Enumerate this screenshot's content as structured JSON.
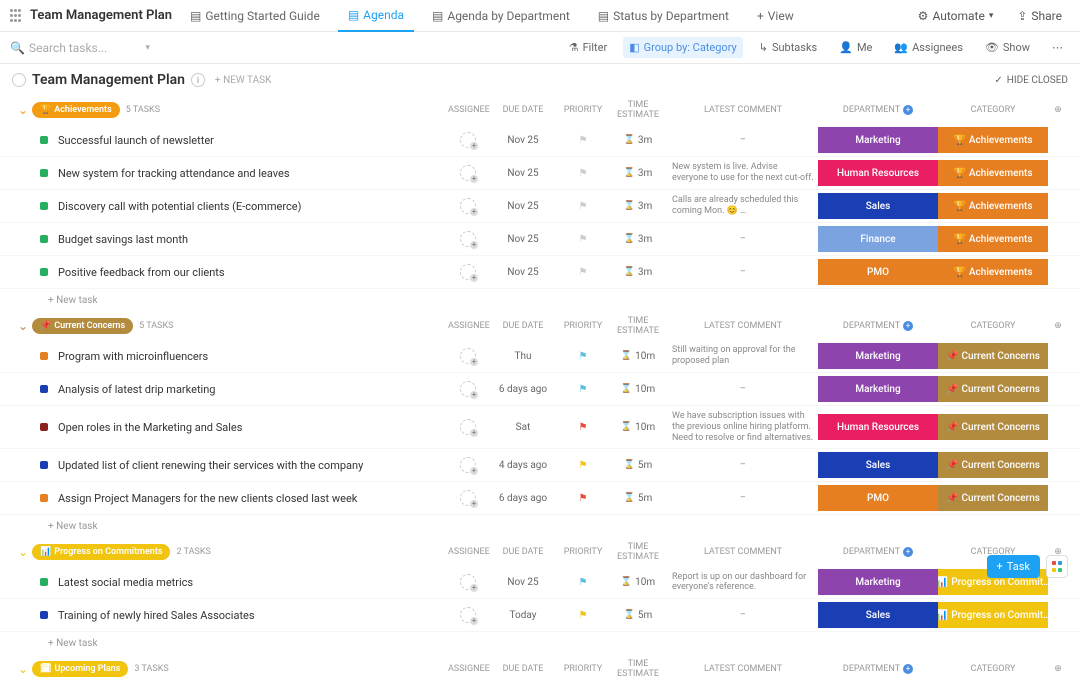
{
  "header": {
    "title": "Team Management Plan",
    "tabs": [
      {
        "label": "Getting Started Guide",
        "active": false
      },
      {
        "label": "Agenda",
        "active": true
      },
      {
        "label": "Agenda by Department",
        "active": false
      },
      {
        "label": "Status by Department",
        "active": false
      }
    ],
    "add_view": "View",
    "automate": "Automate",
    "share": "Share"
  },
  "toolbar": {
    "search_placeholder": "Search tasks...",
    "filter": "Filter",
    "group_by": "Group by: Category",
    "subtasks": "Subtasks",
    "me": "Me",
    "assignees": "Assignees",
    "show": "Show"
  },
  "page": {
    "title": "Team Management Plan",
    "new_task": "+ NEW TASK",
    "hide_closed": "HIDE CLOSED"
  },
  "columns": {
    "assignee": "ASSIGNEE",
    "due_date": "DUE DATE",
    "priority": "PRIORITY",
    "time_estimate": "TIME ESTIMATE",
    "latest_comment": "LATEST COMMENT",
    "department": "DEPARTMENT",
    "category": "CATEGORY"
  },
  "labels": {
    "new_task": "+ New task",
    "fab_task": "Task"
  },
  "groups": [
    {
      "name": "Achievements",
      "badge_color": "#f39c12",
      "icon": "🏆",
      "count": "5 TASKS",
      "tasks": [
        {
          "status": "#27ae60",
          "name": "Successful launch of newsletter",
          "due": "Nov 25",
          "due_cls": "",
          "flag": "gray",
          "time": "3m",
          "comment": "–",
          "dept": "Marketing",
          "dept_color": "#8e44ad",
          "cat": "Achievements",
          "cat_color": "#e67e22",
          "cat_icon": "🏆"
        },
        {
          "status": "#27ae60",
          "name": "New system for tracking attendance and leaves",
          "due": "Nov 25",
          "due_cls": "",
          "flag": "gray",
          "time": "3m",
          "comment": "New system is live. Advise everyone to use for the next cut-off.",
          "dept": "Human Resources",
          "dept_color": "#e91e63",
          "cat": "Achievements",
          "cat_color": "#e67e22",
          "cat_icon": "🏆"
        },
        {
          "status": "#27ae60",
          "name": "Discovery call with potential clients (E-commerce)",
          "due": "Nov 25",
          "due_cls": "",
          "flag": "gray",
          "time": "3m",
          "comment": "Calls are already scheduled this coming Mon. 😊 …",
          "dept": "Sales",
          "dept_color": "#1a3fb5",
          "cat": "Achievements",
          "cat_color": "#e67e22",
          "cat_icon": "🏆"
        },
        {
          "status": "#27ae60",
          "name": "Budget savings last month",
          "due": "Nov 25",
          "due_cls": "",
          "flag": "gray",
          "time": "3m",
          "comment": "–",
          "dept": "Finance",
          "dept_color": "#7aa3e0",
          "cat": "Achievements",
          "cat_color": "#e67e22",
          "cat_icon": "🏆"
        },
        {
          "status": "#27ae60",
          "name": "Positive feedback from our clients",
          "due": "Nov 25",
          "due_cls": "",
          "flag": "gray",
          "time": "3m",
          "comment": "–",
          "dept": "PMO",
          "dept_color": "#e67e22",
          "cat": "Achievements",
          "cat_color": "#e67e22",
          "cat_icon": "🏆"
        }
      ]
    },
    {
      "name": "Current Concerns",
      "badge_color": "#b38b3f",
      "icon": "📌",
      "count": "5 TASKS",
      "tasks": [
        {
          "status": "#e67e22",
          "name": "Program with microinfluencers",
          "due": "Thu",
          "due_cls": "",
          "flag": "blue",
          "time": "10m",
          "comment": "Still waiting on approval for the proposed plan",
          "dept": "Marketing",
          "dept_color": "#8e44ad",
          "cat": "Current Concerns",
          "cat_color": "#b38b3f",
          "cat_icon": "📌"
        },
        {
          "status": "#1a3fb5",
          "name": "Analysis of latest drip marketing",
          "due": "6 days ago",
          "due_cls": "due-red",
          "flag": "blue",
          "time": "10m",
          "comment": "–",
          "dept": "Marketing",
          "dept_color": "#8e44ad",
          "cat": "Current Concerns",
          "cat_color": "#b38b3f",
          "cat_icon": "📌"
        },
        {
          "status": "#8b2020",
          "name": "Open roles in the Marketing and Sales",
          "due": "Sat",
          "due_cls": "due-green",
          "flag": "red",
          "time": "10m",
          "comment": "We have subscription issues with the previous online hiring platform. Need to resolve or find alternatives.",
          "dept": "Human Resources",
          "dept_color": "#e91e63",
          "cat": "Current Concerns",
          "cat_color": "#b38b3f",
          "cat_icon": "📌"
        },
        {
          "status": "#1a3fb5",
          "name": "Updated list of client renewing their services with the company",
          "due": "4 days ago",
          "due_cls": "due-red",
          "flag": "yellow",
          "time": "5m",
          "comment": "–",
          "dept": "Sales",
          "dept_color": "#1a3fb5",
          "cat": "Current Concerns",
          "cat_color": "#b38b3f",
          "cat_icon": "📌"
        },
        {
          "status": "#e67e22",
          "name": "Assign Project Managers for the new clients closed last week",
          "due": "6 days ago",
          "due_cls": "due-red",
          "flag": "red",
          "time": "5m",
          "comment": "–",
          "dept": "PMO",
          "dept_color": "#e67e22",
          "cat": "Current Concerns",
          "cat_color": "#b38b3f",
          "cat_icon": "📌"
        }
      ]
    },
    {
      "name": "Progress on Commitments",
      "badge_color": "#f1c40f",
      "icon": "📊",
      "count": "2 TASKS",
      "tasks": [
        {
          "status": "#27ae60",
          "name": "Latest social media metrics",
          "due": "Nov 25",
          "due_cls": "",
          "flag": "blue",
          "time": "10m",
          "comment": "Report is up on our dashboard for everyone's reference.",
          "dept": "Marketing",
          "dept_color": "#8e44ad",
          "cat": "Progress on Commit…",
          "cat_color": "#f1c40f",
          "cat_icon": "📊"
        },
        {
          "status": "#1a3fb5",
          "name": "Training of newly hired Sales Associates",
          "due": "Today",
          "due_cls": "due-red",
          "flag": "yellow",
          "time": "5m",
          "comment": "–",
          "dept": "Sales",
          "dept_color": "#1a3fb5",
          "cat": "Progress on Commit…",
          "cat_color": "#f1c40f",
          "cat_icon": "📊"
        }
      ]
    },
    {
      "name": "Upcoming Plans",
      "badge_color": "#f1c40f",
      "icon": "🗓",
      "count": "3 TASKS",
      "tasks": []
    }
  ]
}
